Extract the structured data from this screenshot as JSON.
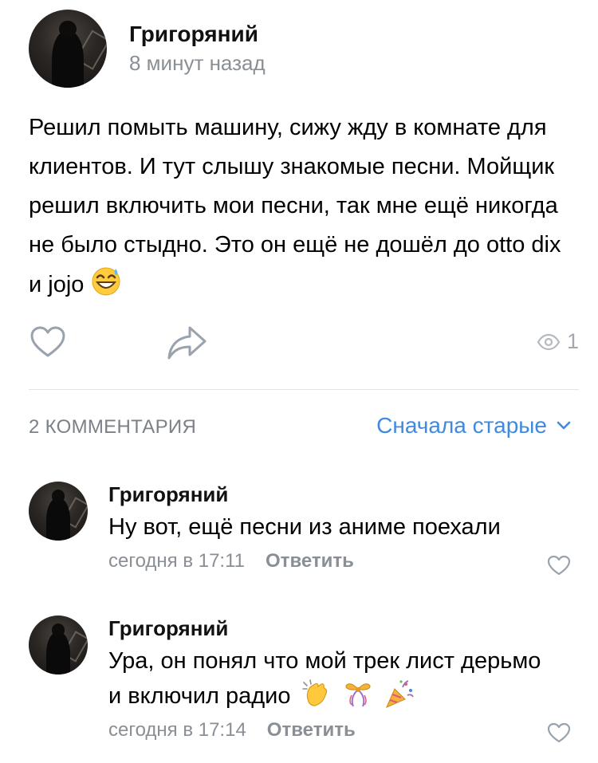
{
  "post": {
    "author": "Григоряний",
    "time": "8 минут назад",
    "text": "Решил помыть машину, сижу жду в комнате для клиентов. И тут слышу знакомые песни. Мойщик решил включить мои песни, так мне ещё никогда не было стыдно. Это он ещё не дошёл до otto dix и jojo",
    "views": "1"
  },
  "comments_section": {
    "count_label": "2 КОММЕНТАРИЯ",
    "sort_label": "Сначала старые"
  },
  "comments": [
    {
      "author": "Григоряний",
      "text": "Ну вот, ещё песни из аниме поехали",
      "time": "сегодня в 17:11",
      "reply_label": "Ответить"
    },
    {
      "author": "Григоряний",
      "text": "Ура, он понял что  мой трек лист дерьмо и включил радио",
      "time": "сегодня в 17:14",
      "reply_label": "Ответить"
    }
  ],
  "colors": {
    "accent": "#3f8ae0",
    "secondary_text": "#8a8f95",
    "icon": "#99a2ad"
  },
  "icons": [
    "avatar",
    "heart-icon",
    "share-icon",
    "eye-icon",
    "chevron-down-icon",
    "sweat-smile-emoji",
    "clapping-hands-emoji",
    "ribbon-emoji",
    "party-popper-emoji"
  ]
}
